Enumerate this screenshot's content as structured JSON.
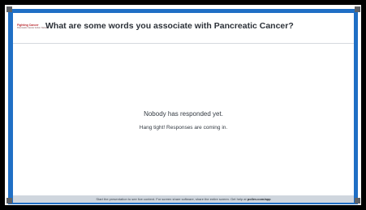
{
  "logo": {
    "line1": "Fighting Cancer",
    "line2": "Pancreatic Cancer Action Network"
  },
  "question": "What are some words you associate with Pancreatic Cancer?",
  "empty_state": {
    "title": "Nobody has responded yet.",
    "subtitle": "Hang tight! Responses are coming in."
  },
  "footer": {
    "text": "Start the presentation to see live content. For screen share software, share the entire screen. Get help at ",
    "link": "pollev.com/app"
  },
  "colors": {
    "border_blue": "#1f6fc5",
    "footer_bg": "#cfd6de",
    "handle": "#5e6166"
  }
}
